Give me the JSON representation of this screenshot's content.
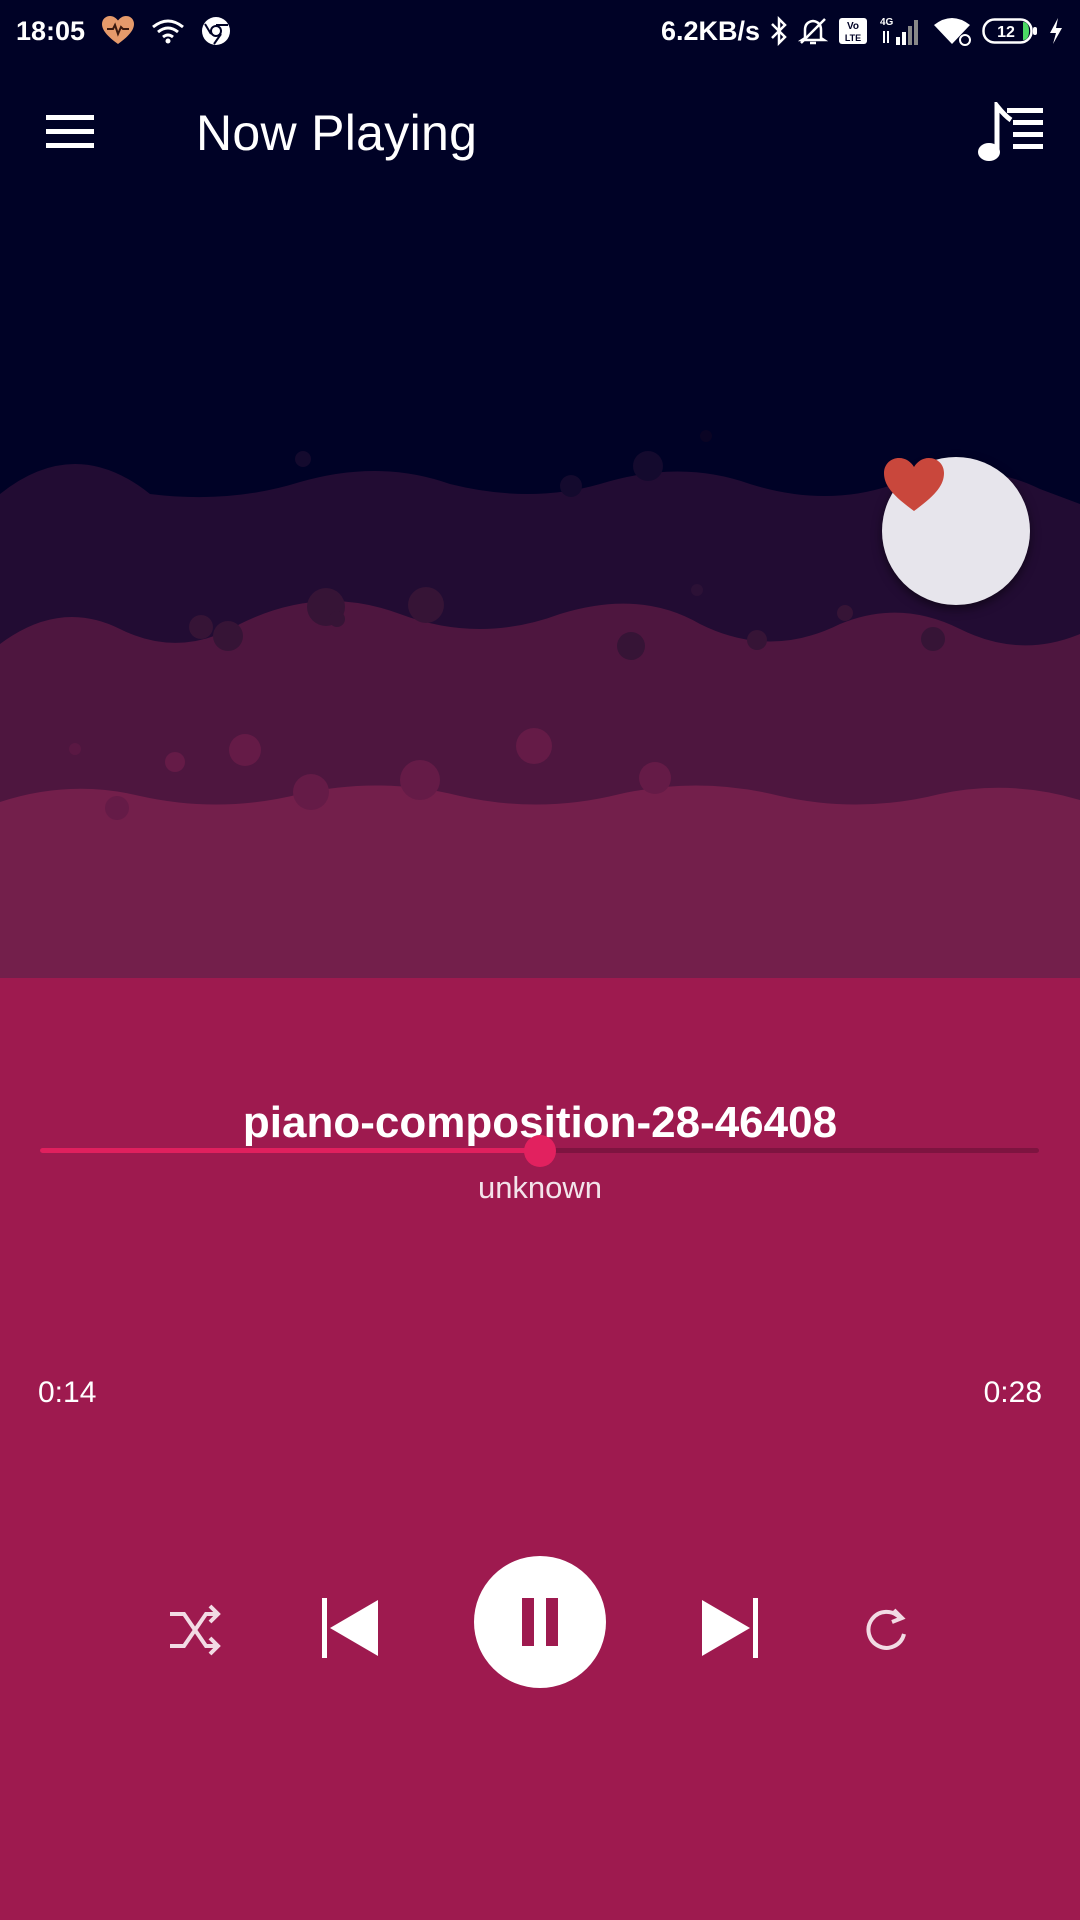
{
  "status_bar": {
    "time": "18:05",
    "network_speed": "6.2KB/s",
    "network_type": "4G",
    "volte": "Vo LTE",
    "battery_level": "12",
    "icons": [
      "heart-rate-icon",
      "wifi-calling-icon",
      "chrome-icon",
      "bluetooth-icon",
      "mute-bell-icon",
      "volte-icon",
      "signal-icon",
      "wifi-icon",
      "battery-icon",
      "charging-icon"
    ]
  },
  "app_bar": {
    "title": "Now Playing",
    "menu_icon": "hamburger-menu-icon",
    "queue_icon": "music-queue-icon"
  },
  "favorite": {
    "icon": "heart-icon",
    "color": "#c9473c",
    "active": true
  },
  "track": {
    "title": "piano-composition-28-46408",
    "artist": "unknown"
  },
  "progress": {
    "current": "0:14",
    "total": "0:28",
    "fraction": 0.5
  },
  "controls": {
    "shuffle": "shuffle-icon",
    "previous": "skip-previous-icon",
    "play_pause": "pause-icon",
    "next": "skip-next-icon",
    "repeat": "repeat-icon"
  },
  "colors": {
    "background": "#000226",
    "wave_1": "#220c33",
    "wave_2": "#4e163f",
    "wave_3": "#731f4b",
    "panel": "#9e1a4f",
    "accent": "#e0205e"
  }
}
